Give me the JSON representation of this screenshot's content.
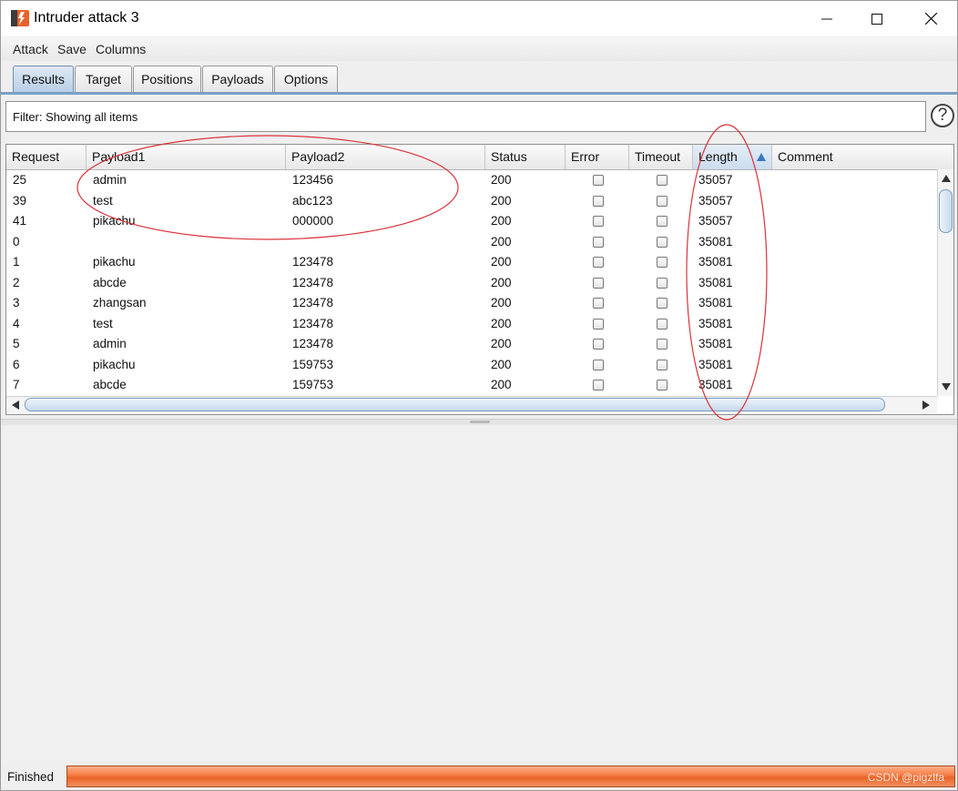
{
  "window": {
    "title": "Intruder attack 3"
  },
  "menu": [
    "Attack",
    "Save",
    "Columns"
  ],
  "tabs": [
    "Results",
    "Target",
    "Positions",
    "Payloads",
    "Options"
  ],
  "active_tab": "Results",
  "filter": {
    "text": "Filter:  Showing all items",
    "help": "?"
  },
  "table": {
    "headers": [
      "Request",
      "Payload1",
      "Payload2",
      "Status",
      "Error",
      "Timeout",
      "Length",
      "Comment"
    ],
    "sorted_by": "Length",
    "rows": [
      {
        "request": "25",
        "payload1": "admin",
        "payload2": "123456",
        "status": "200",
        "error": false,
        "timeout": false,
        "length": "35057"
      },
      {
        "request": "39",
        "payload1": "test",
        "payload2": "abc123",
        "status": "200",
        "error": false,
        "timeout": false,
        "length": "35057"
      },
      {
        "request": "41",
        "payload1": "pikachu",
        "payload2": "000000",
        "status": "200",
        "error": false,
        "timeout": false,
        "length": "35057"
      },
      {
        "request": "0",
        "payload1": "",
        "payload2": "",
        "status": "200",
        "error": false,
        "timeout": false,
        "length": "35081"
      },
      {
        "request": "1",
        "payload1": "pikachu",
        "payload2": "123478",
        "status": "200",
        "error": false,
        "timeout": false,
        "length": "35081"
      },
      {
        "request": "2",
        "payload1": "abcde",
        "payload2": "123478",
        "status": "200",
        "error": false,
        "timeout": false,
        "length": "35081"
      },
      {
        "request": "3",
        "payload1": "zhangsan",
        "payload2": "123478",
        "status": "200",
        "error": false,
        "timeout": false,
        "length": "35081"
      },
      {
        "request": "4",
        "payload1": "test",
        "payload2": "123478",
        "status": "200",
        "error": false,
        "timeout": false,
        "length": "35081"
      },
      {
        "request": "5",
        "payload1": "admin",
        "payload2": "123478",
        "status": "200",
        "error": false,
        "timeout": false,
        "length": "35081"
      },
      {
        "request": "6",
        "payload1": "pikachu",
        "payload2": "159753",
        "status": "200",
        "error": false,
        "timeout": false,
        "length": "35081"
      },
      {
        "request": "7",
        "payload1": "abcde",
        "payload2": "159753",
        "status": "200",
        "error": false,
        "timeout": false,
        "length": "35081"
      }
    ]
  },
  "status": {
    "label": "Finished",
    "progress": 1.0,
    "watermark": "CSDN @pigzlfa"
  },
  "colors": {
    "accent": "#7aa0c6",
    "progress": "#f47b42",
    "annotation": "#d9333a"
  }
}
